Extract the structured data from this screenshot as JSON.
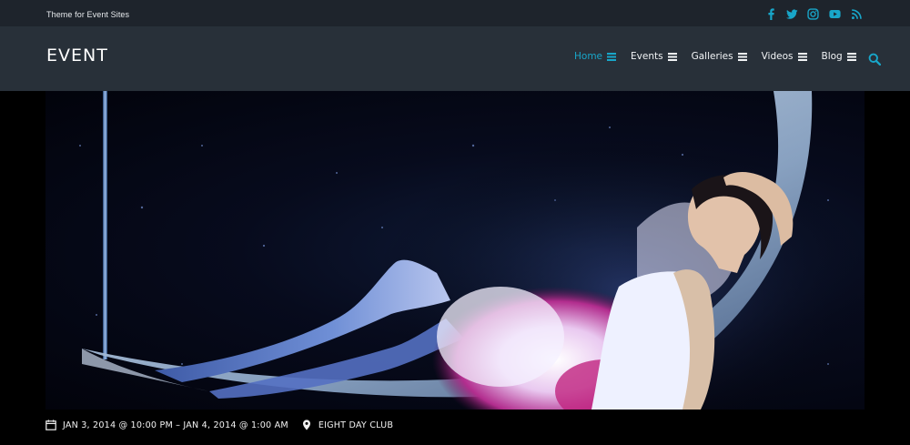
{
  "topbar": {
    "tagline": "Theme for Event Sites",
    "social": [
      "facebook-icon",
      "twitter-icon",
      "instagram-icon",
      "youtube-icon",
      "rss-icon"
    ]
  },
  "header": {
    "logo": "EVENT",
    "nav": [
      {
        "label": "Home",
        "active": true
      },
      {
        "label": "Events",
        "active": false
      },
      {
        "label": "Galleries",
        "active": false
      },
      {
        "label": "Videos",
        "active": false
      },
      {
        "label": "Blog",
        "active": false
      }
    ],
    "search_icon": "search-icon"
  },
  "event": {
    "date_range": "JAN 3, 2014 @ 10:00 PM – JAN 4, 2014 @ 1:00 AM",
    "venue": "EIGHT DAY CLUB"
  },
  "colors": {
    "accent": "#18a6c9",
    "topbar_bg": "#1e242c",
    "header_bg": "#283039",
    "page_bg": "#000000"
  }
}
